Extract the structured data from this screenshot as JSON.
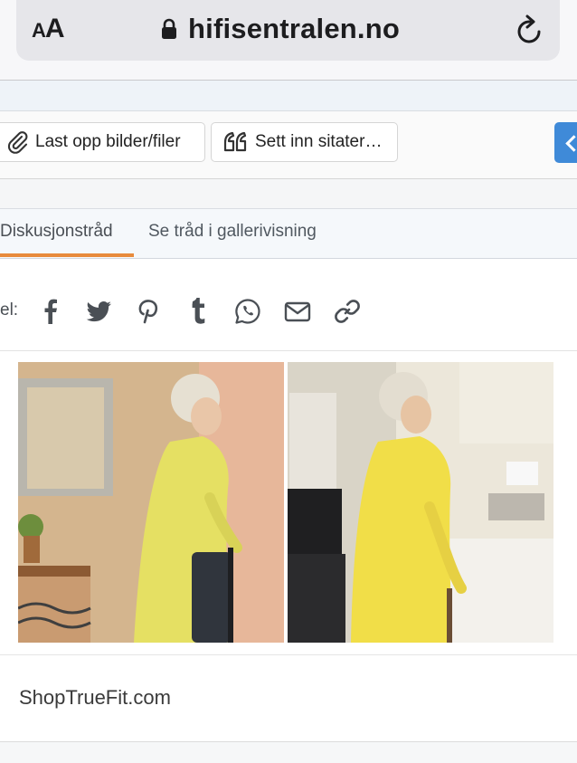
{
  "browser": {
    "aa_small": "A",
    "aa_big": "A",
    "url": "hifisentralen.no"
  },
  "toolbar": {
    "upload_label": "Last opp bilder/filer",
    "quote_label": "Sett inn sitater…"
  },
  "tabs": [
    {
      "label": "Diskusjonstråd",
      "active": true
    },
    {
      "label": "Se tråd i gallerivisning",
      "active": false
    }
  ],
  "share": {
    "label": "el:",
    "icons": [
      "facebook-icon",
      "twitter-icon",
      "pinterest-icon",
      "tumblr-icon",
      "whatsapp-icon",
      "email-icon",
      "link-icon"
    ]
  },
  "ad": {
    "domain_text": "ShopTrueFit.com"
  },
  "colors": {
    "tab_accent": "#e88b3c",
    "button_blue": "#3f8ad8",
    "icon_gray": "#4a4f55"
  }
}
